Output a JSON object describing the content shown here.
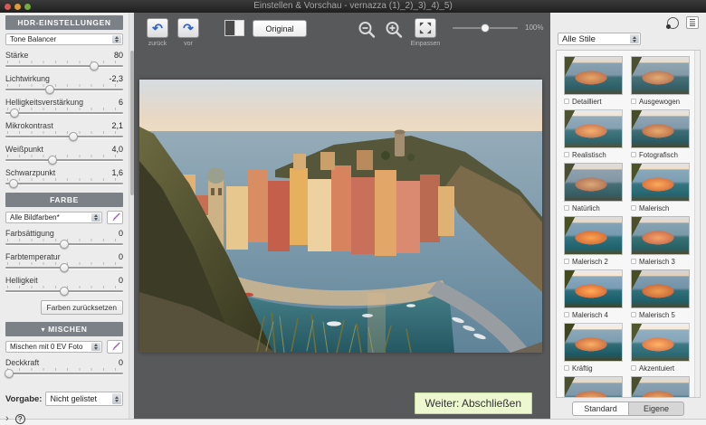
{
  "window": {
    "title": "Einstellen & Vorschau - vernazza (1)_2)_3)_4)_5)"
  },
  "icons": {
    "chevron_down": "▾",
    "disclosure": "›",
    "help": "?",
    "undo_arrow": "↶",
    "redo_arrow": "↷"
  },
  "left_panel": {
    "hdr_header": "HDR-EINSTELLUNGEN",
    "method_select": "Tone Balancer",
    "hdr_sliders": [
      {
        "label": "Stärke",
        "value": "80",
        "pos": 75
      },
      {
        "label": "Lichtwirkung",
        "value": "-2,3",
        "pos": 38
      },
      {
        "label": "Helligkeitsverstärkung",
        "value": "6",
        "pos": 8
      },
      {
        "label": "Mikrokontrast",
        "value": "2,1",
        "pos": 58
      },
      {
        "label": "Weißpunkt",
        "value": "4,0",
        "pos": 40
      },
      {
        "label": "Schwarzpunkt",
        "value": "1,6",
        "pos": 7
      }
    ],
    "farbe_header": "FARBE",
    "color_select": "Alle Bildfarben*",
    "color_sliders": [
      {
        "label": "Farbsättigung",
        "value": "0",
        "pos": 50
      },
      {
        "label": "Farbtemperatur",
        "value": "0",
        "pos": 50
      },
      {
        "label": "Helligkeit",
        "value": "0",
        "pos": 50
      }
    ],
    "reset_colors_label": "Farben zurücksetzen",
    "mischen_header": "MISCHEN",
    "blend_select": "Mischen mit  0 EV Foto",
    "blend_slider": {
      "label": "Deckkraft",
      "value": "0",
      "pos": 3
    },
    "vorgabe_label": "Vorgabe:",
    "vorgabe_select": "Nicht gelistet"
  },
  "toolbar": {
    "undo_label": "zurück",
    "vor_label": "vor",
    "original_label": "Original",
    "fit_label": "Einpassen",
    "zoom_value": "100%"
  },
  "footer": {
    "next_label": "Weiter: Abschließen"
  },
  "right_panel": {
    "styles_select": "Alle Stile",
    "presets": [
      "Detailliert",
      "Ausgewogen",
      "Realistisch",
      "Fotografisch",
      "Natürlich",
      "Malerisch",
      "Malerisch 2",
      "Malerisch 3",
      "Malerisch 4",
      "Malerisch 5",
      "Kräftig",
      "Akzentuiert"
    ],
    "tabs": [
      {
        "label": "Standard"
      },
      {
        "label": "Eigene"
      }
    ]
  },
  "colors": {
    "accent_green_button": "#edf7d0",
    "panel_header": "#7b8187",
    "center_bg": "#58595b",
    "undo_blue": "#2e62c9"
  }
}
